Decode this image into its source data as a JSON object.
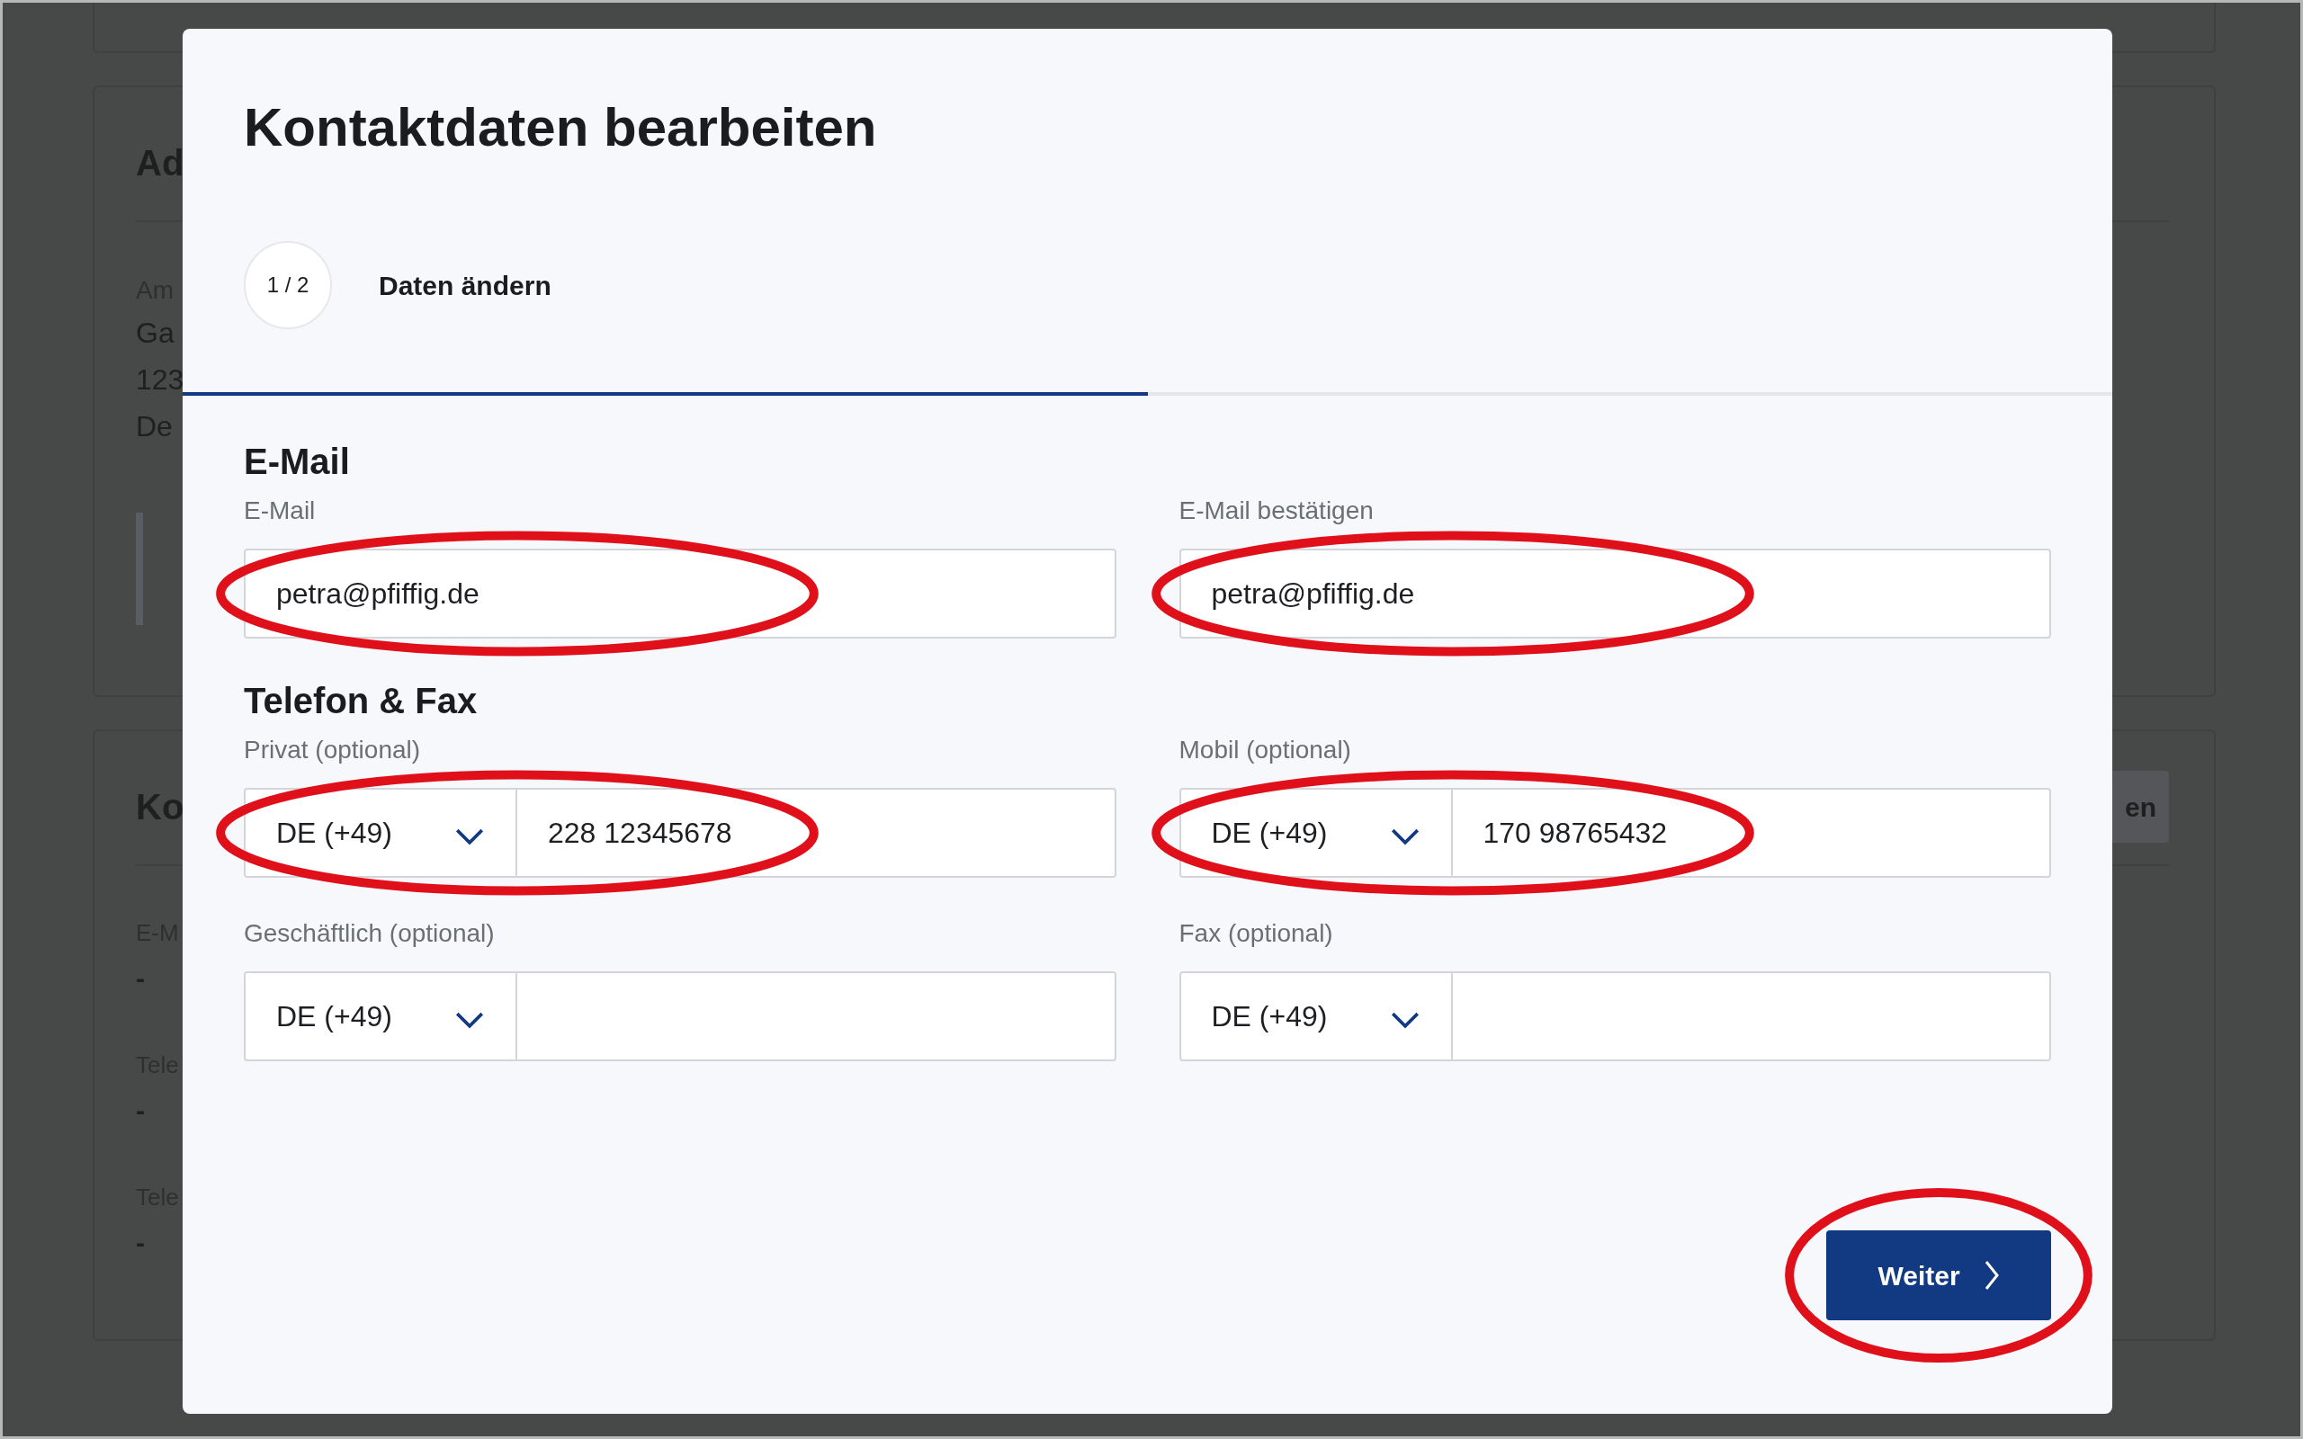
{
  "background": {
    "cards": [
      {
        "kind": "collapsed"
      },
      {
        "kind": "panel",
        "heading": "Ad",
        "label": "Am",
        "lines": [
          "Ga",
          "123",
          "De"
        ]
      },
      {
        "kind": "panel",
        "heading": "Ko",
        "items": [
          {
            "label": "E-M",
            "value": "-"
          },
          {
            "label": "Tele",
            "value": "-"
          },
          {
            "label": "Tele",
            "value": "-"
          }
        ],
        "button": "en"
      }
    ]
  },
  "dialog": {
    "title": "Kontaktdaten bearbeiten",
    "step": {
      "counter": "1 / 2",
      "label": "Daten ändern",
      "level": 0.5
    },
    "sections": [
      {
        "heading": "E-Mail",
        "fields": [
          {
            "kind": "text",
            "label": "E-Mail",
            "value": "petra@pfiffig.de",
            "highlighted": true
          },
          {
            "kind": "text",
            "label": "E-Mail bestätigen",
            "value": "petra@pfiffig.de",
            "highlighted": true
          }
        ]
      },
      {
        "heading": "Telefon & Fax",
        "fields": [
          {
            "kind": "phone",
            "label": "Privat (optional)",
            "country": "DE (+49)",
            "value": "228 12345678",
            "highlighted": true
          },
          {
            "kind": "phone",
            "label": "Mobil (optional)",
            "country": "DE (+49)",
            "value": "170 98765432",
            "highlighted": true
          },
          {
            "kind": "phone",
            "label": "Geschäftlich (optional)",
            "country": "DE (+49)",
            "highlighted": false
          },
          {
            "kind": "phone",
            "label": "Fax (optional)",
            "country": "DE (+49)",
            "highlighted": false
          }
        ]
      }
    ],
    "next_button": {
      "label": "Weiter",
      "highlighted": true
    }
  }
}
